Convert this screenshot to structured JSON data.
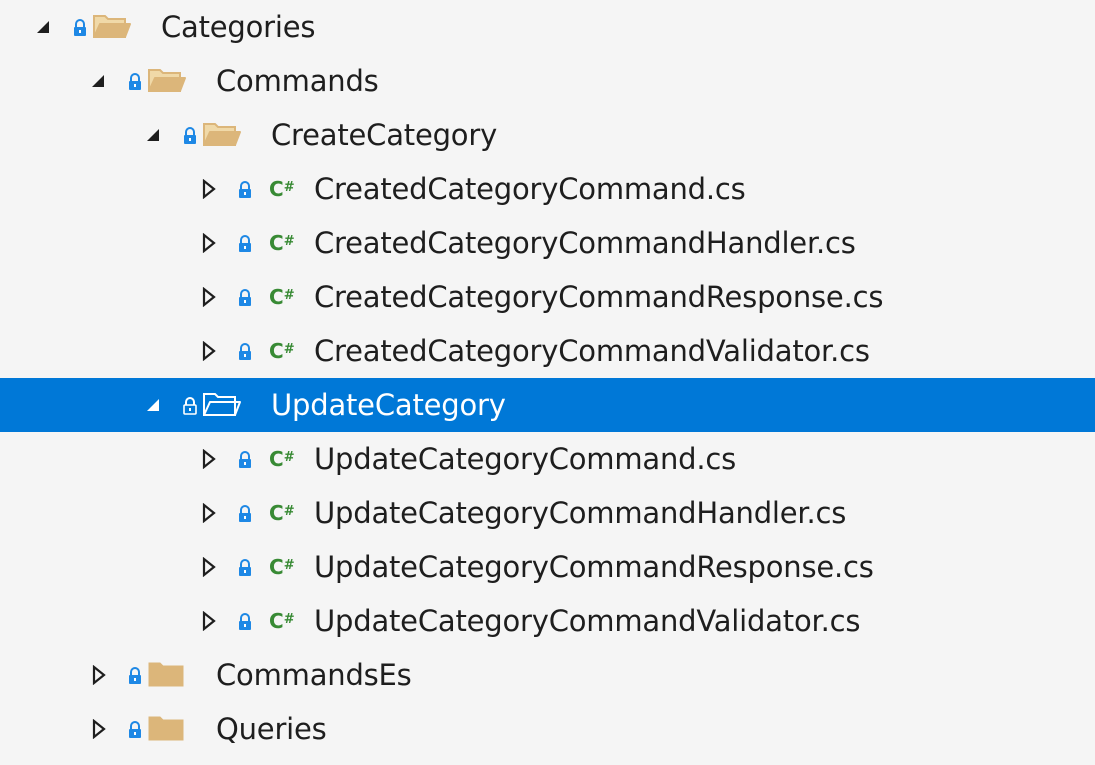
{
  "tree": {
    "items": [
      {
        "label": "Categories",
        "kind": "folder-open",
        "expander": "expanded",
        "depth": 0
      },
      {
        "label": "Commands",
        "kind": "folder-open",
        "expander": "expanded",
        "depth": 1
      },
      {
        "label": "CreateCategory",
        "kind": "folder-open",
        "expander": "expanded",
        "depth": 2
      },
      {
        "label": "CreatedCategoryCommand.cs",
        "kind": "csharp-file",
        "expander": "collapsed",
        "depth": 3
      },
      {
        "label": "CreatedCategoryCommandHandler.cs",
        "kind": "csharp-file",
        "expander": "collapsed",
        "depth": 3
      },
      {
        "label": "CreatedCategoryCommandResponse.cs",
        "kind": "csharp-file",
        "expander": "collapsed",
        "depth": 3
      },
      {
        "label": "CreatedCategoryCommandValidator.cs",
        "kind": "csharp-file",
        "expander": "collapsed",
        "depth": 3
      },
      {
        "label": "UpdateCategory",
        "kind": "folder-open",
        "expander": "expanded",
        "depth": 2,
        "selected": true
      },
      {
        "label": "UpdateCategoryCommand.cs",
        "kind": "csharp-file",
        "expander": "collapsed",
        "depth": 3
      },
      {
        "label": "UpdateCategoryCommandHandler.cs",
        "kind": "csharp-file",
        "expander": "collapsed",
        "depth": 3
      },
      {
        "label": "UpdateCategoryCommandResponse.cs",
        "kind": "csharp-file",
        "expander": "collapsed",
        "depth": 3
      },
      {
        "label": "UpdateCategoryCommandValidator.cs",
        "kind": "csharp-file",
        "expander": "collapsed",
        "depth": 3
      },
      {
        "label": "CommandsEs",
        "kind": "folder-closed",
        "expander": "collapsed",
        "depth": 1
      },
      {
        "label": "Queries",
        "kind": "folder-closed",
        "expander": "collapsed",
        "depth": 1
      }
    ]
  },
  "icons": {
    "expanded": "triangle-expanded-icon",
    "collapsed": "triangle-collapsed-icon",
    "lock": "lock-icon",
    "folder_open": "folder-open-icon",
    "folder_closed": "folder-closed-icon",
    "csharp": "csharp-file-icon",
    "csharp_text": "C",
    "csharp_hash": "#"
  },
  "colors": {
    "background": "#f5f5f5",
    "selection": "#0078d7",
    "text": "#1e1e1e",
    "selected_text": "#ffffff",
    "folder_fill": "#dcb67a",
    "folder_light": "#f0d9a8",
    "lock_blue": "#1e88e5",
    "csharp_green": "#388a34",
    "expander": "#1e1e1e"
  }
}
